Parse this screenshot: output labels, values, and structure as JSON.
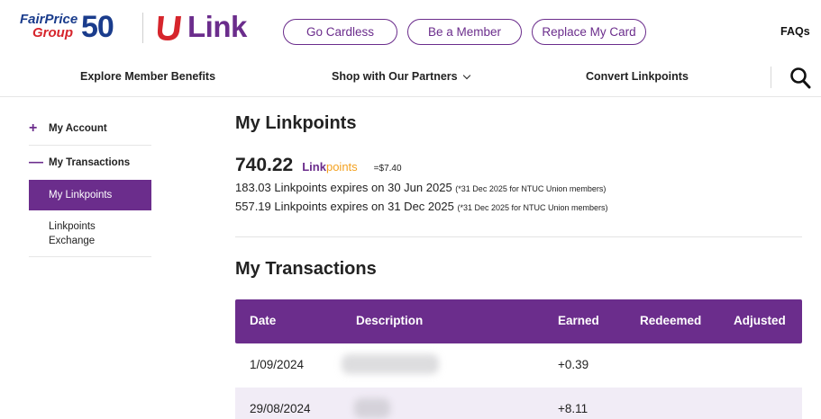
{
  "header": {
    "brand_line1": "FairPrice",
    "brand_line2": "Group",
    "brand_number": "50",
    "link_word": "Link",
    "buttons": [
      "Go Cardless",
      "Be a Member",
      "Replace My Card"
    ],
    "faqs": "FAQs"
  },
  "nav": {
    "items": [
      "Explore Member Benefits",
      "Shop with Our Partners",
      "Convert Linkpoints"
    ]
  },
  "sidebar": {
    "my_account": "My Account",
    "my_transactions": "My Transactions",
    "my_linkpoints": "My Linkpoints",
    "linkpoints_exchange_1": "Linkpoints",
    "linkpoints_exchange_2": "Exchange",
    "plus": "+",
    "minus": "—"
  },
  "linkpoints": {
    "title": "My Linkpoints",
    "balance": "740.22",
    "brand_a": "Link",
    "brand_b": "points",
    "equivalent": "=$7.40",
    "expiry": [
      {
        "text": "183.03 Linkpoints expires on 30 Jun 2025 ",
        "note": "(*31 Dec 2025 for NTUC Union members)"
      },
      {
        "text": "557.19 Linkpoints expires on 31 Dec 2025 ",
        "note": "(*31 Dec 2025 for NTUC Union members)"
      }
    ]
  },
  "transactions": {
    "title": "My Transactions",
    "columns": [
      "Date",
      "Description",
      "Earned",
      "Redeemed",
      "Adjusted"
    ],
    "rows": [
      {
        "date": "1/09/2024",
        "earned": "+0.39"
      },
      {
        "date": "29/08/2024",
        "earned": "+8.11"
      }
    ]
  },
  "colors": {
    "brand_purple": "#6b2d8c",
    "points_orange": "#f4a11f",
    "fairprice_blue": "#1a3c8c",
    "fairprice_red": "#d6252c"
  }
}
